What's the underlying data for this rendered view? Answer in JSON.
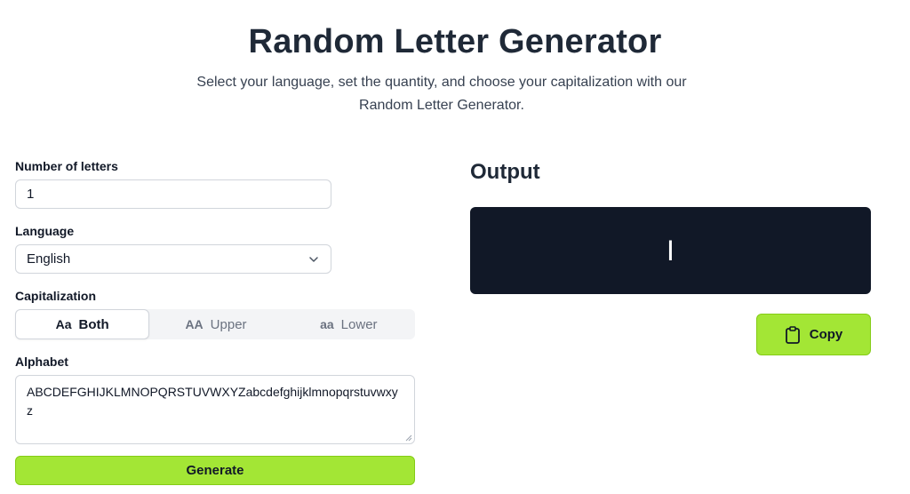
{
  "header": {
    "title": "Random Letter Generator",
    "subtitle": "Select your language, set the quantity, and choose your capitalization with our Random Letter Generator."
  },
  "form": {
    "count_label": "Number of letters",
    "count_value": "1",
    "language_label": "Language",
    "language_value": "English",
    "capitalization_label": "Capitalization",
    "capitalization_options": [
      {
        "icon": "Aa",
        "label": "Both",
        "active": true
      },
      {
        "icon": "AA",
        "label": "Upper",
        "active": false
      },
      {
        "icon": "aa",
        "label": "Lower",
        "active": false
      }
    ],
    "alphabet_label": "Alphabet",
    "alphabet_value": "ABCDEFGHIJKLMNOPQRSTUVWXYZabcdefghijklmnopqrstuvwxyz",
    "generate_label": "Generate"
  },
  "output": {
    "title": "Output",
    "value": "I",
    "copy_label": "Copy",
    "copy_icon": "clipboard-icon"
  },
  "colors": {
    "accent": "#a3e635",
    "output_bg": "#111827"
  }
}
